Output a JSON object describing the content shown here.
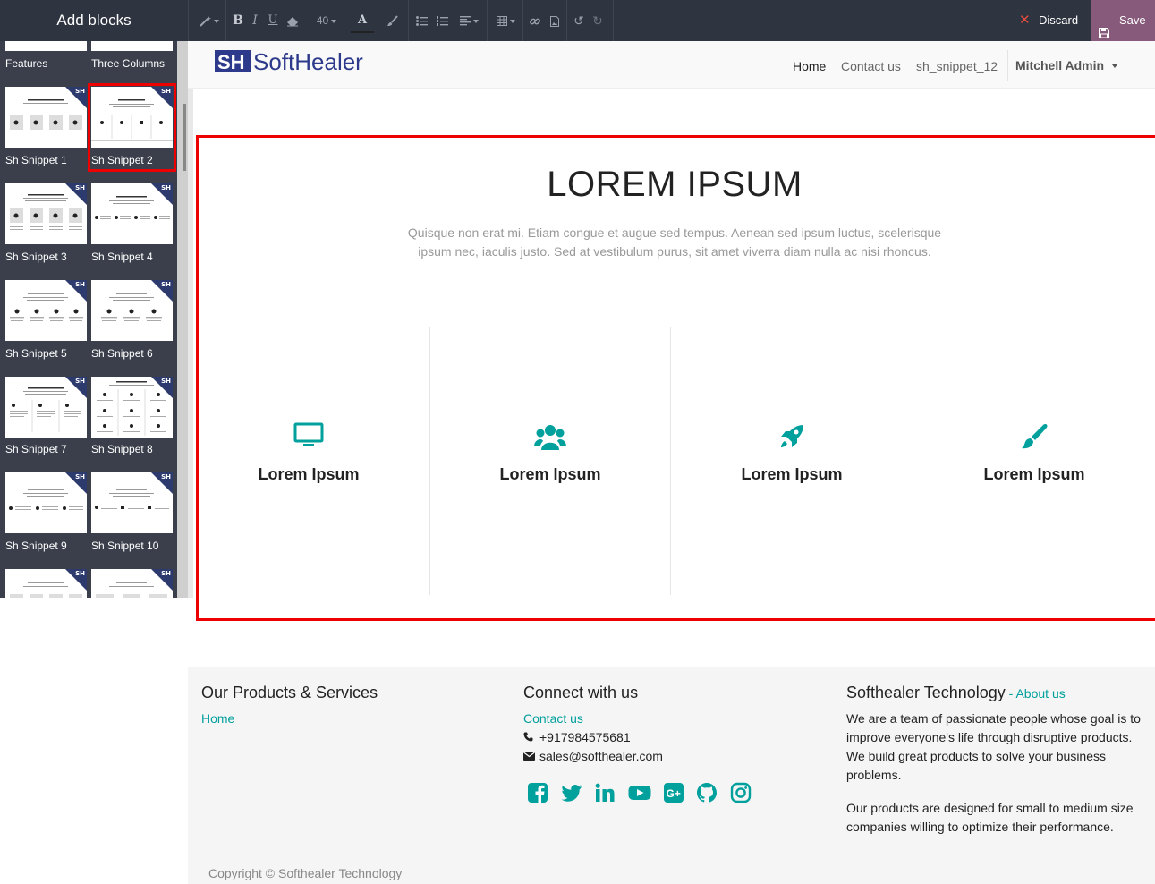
{
  "editor": {
    "panel_title": "Add blocks",
    "font_size": "40",
    "discard_label": "Discard",
    "save_label": "Save"
  },
  "blocks": [
    {
      "label": "Features"
    },
    {
      "label": "Three Columns"
    },
    {
      "label": "Sh Snippet 1"
    },
    {
      "label": "Sh Snippet 2"
    },
    {
      "label": "Sh Snippet 3"
    },
    {
      "label": "Sh Snippet 4"
    },
    {
      "label": "Sh Snippet 5"
    },
    {
      "label": "Sh Snippet 6"
    },
    {
      "label": "Sh Snippet 7"
    },
    {
      "label": "Sh Snippet 8"
    },
    {
      "label": "Sh Snippet 9"
    },
    {
      "label": "Sh Snippet 10"
    }
  ],
  "badge_text": "SH",
  "site": {
    "logo_text": "SoftHealer",
    "nav": [
      "Home",
      "Contact us",
      "sh_snippet_12"
    ],
    "user": "Mitchell Admin"
  },
  "snippet": {
    "title": "LOREM IPSUM",
    "desc_line1": "Quisque non erat mi. Etiam congue et augue sed tempus. Aenean sed ipsum luctus, scelerisque",
    "desc_line2": "ipsum nec, iaculis justo. Sed at vestibulum purus, sit amet viverra diam nulla ac nisi rhoncus.",
    "features": [
      {
        "icon": "monitor-icon",
        "title": "Lorem Ipsum"
      },
      {
        "icon": "users-icon",
        "title": "Lorem Ipsum"
      },
      {
        "icon": "rocket-icon",
        "title": "Lorem Ipsum"
      },
      {
        "icon": "paint-brush-icon",
        "title": "Lorem Ipsum"
      }
    ]
  },
  "footer": {
    "products_heading": "Our Products & Services",
    "products_link": "Home",
    "connect_heading": "Connect with us",
    "contact_link": "Contact us",
    "phone": "+917984575681",
    "email": "sales@softhealer.com",
    "about_heading": "Softhealer Technology",
    "about_sep": " - ",
    "about_link": "About us",
    "about_p1": "We are a team of passionate people whose goal is to improve everyone's life through disruptive products. We build great products to solve your business problems.",
    "about_p2": "Our products are designed for small to medium size companies willing to optimize their performance.",
    "social": [
      "facebook-icon",
      "twitter-icon",
      "linkedin-icon",
      "youtube-icon",
      "google-plus-icon",
      "github-icon",
      "instagram-icon"
    ],
    "copyright": "Copyright © Softhealer Technology"
  },
  "colors": {
    "accent": "#00a09d",
    "toolbar": "#2f3441",
    "save": "#875a7b",
    "selection": "#ee0000",
    "logo_blue": "#2d3a8c"
  }
}
